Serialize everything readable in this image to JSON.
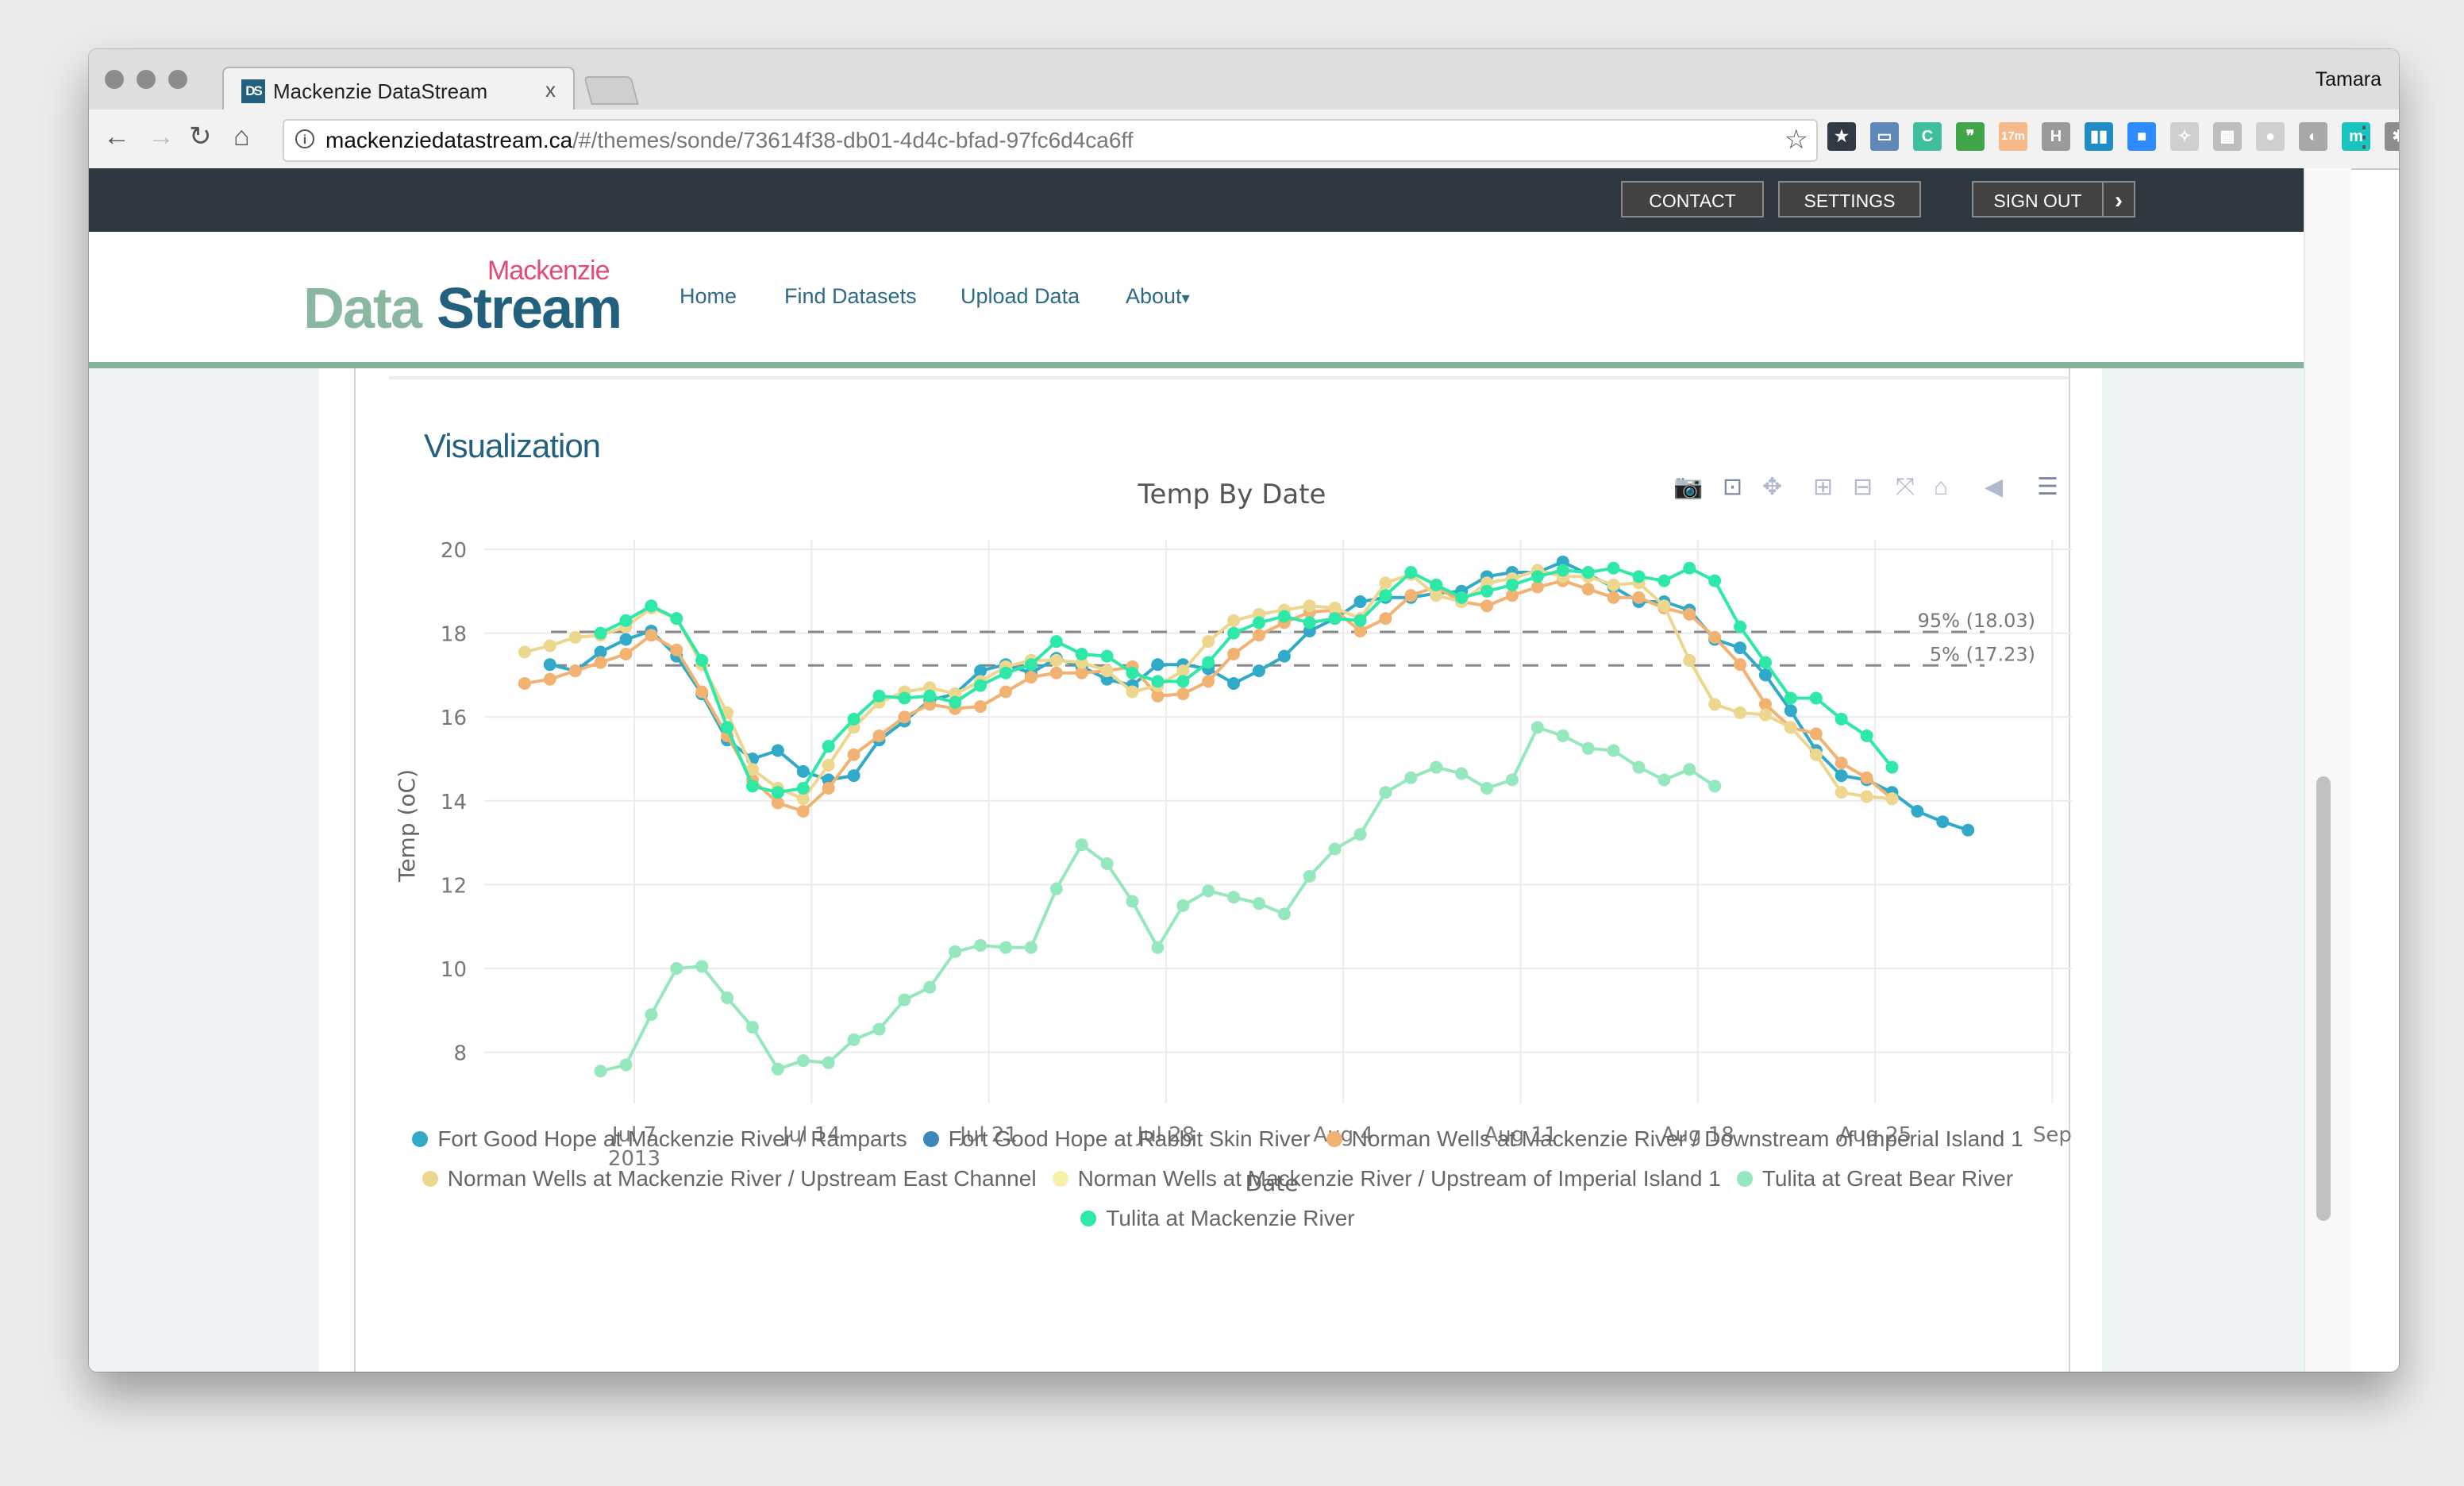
{
  "browser": {
    "tab_title": "Mackenzie DataStream",
    "tab_favicon": "DS",
    "tab_close": "x",
    "profile_name": "Tamara",
    "url_host": "mackenziedatastream.ca",
    "url_path": "/#/themes/sonde/73614f38-db01-4d4c-bfad-97fc6d4ca6ff",
    "extensions": [
      {
        "name": "calendar-star-icon",
        "label": "★",
        "color": "#2f3a45"
      },
      {
        "name": "screen-capture-icon",
        "label": "▭",
        "color": "#5f88b8"
      },
      {
        "name": "c-extension-icon",
        "label": "C",
        "color": "#3fbf9f"
      },
      {
        "name": "hangouts-icon",
        "label": "❞",
        "color": "#3fa548"
      },
      {
        "name": "timer-extension-icon",
        "label": "17m",
        "color": "#f6b98a"
      },
      {
        "name": "h-extension-icon",
        "label": "H",
        "color": "#9a9a9a"
      },
      {
        "name": "trello-icon",
        "label": "▮▮",
        "color": "#1f8dc4"
      },
      {
        "name": "zoom-icon",
        "label": "■",
        "color": "#2d8cff"
      },
      {
        "name": "ghost-extension-icon",
        "label": "✧",
        "color": "#cfcfcf"
      },
      {
        "name": "map-extension-icon",
        "label": "▦",
        "color": "#bdbdbd"
      },
      {
        "name": "dot-extension-icon",
        "label": "●",
        "color": "#cfcfcf"
      },
      {
        "name": "shield-extension-icon",
        "label": "◐",
        "color": "#a8a8a8"
      },
      {
        "name": "m-extension-icon",
        "label": "m",
        "color": "#19c4c0"
      },
      {
        "name": "hubspot-icon",
        "label": "✱",
        "color": "#8d8d8d"
      }
    ]
  },
  "topbar": {
    "contact": "CONTACT",
    "settings": "SETTINGS",
    "signout": "SIGN OUT",
    "signout_arrow": "›"
  },
  "header": {
    "logo_small": "Mackenzie",
    "logo_data": "Data",
    "logo_stream": "Stream",
    "nav": [
      "Home",
      "Find Datasets",
      "Upload Data",
      "About"
    ],
    "about_caret": "▾"
  },
  "section_title": "Visualization",
  "chart_data": {
    "type": "line",
    "title": "Temp By Date",
    "xlabel": "Date",
    "ylabel": "Temp (oC)",
    "x_range": [
      "2013-07-02",
      "2013-09-01"
    ],
    "ylim": [
      6.8,
      20.4
    ],
    "yticks": [
      8,
      10,
      12,
      14,
      16,
      18,
      20
    ],
    "xticks": [
      {
        "date": "2013-07-07",
        "label": "Jul 7",
        "sublabel": "2013"
      },
      {
        "date": "2013-07-14",
        "label": "Jul 14"
      },
      {
        "date": "2013-07-21",
        "label": "Jul 21"
      },
      {
        "date": "2013-07-28",
        "label": "Jul 28"
      },
      {
        "date": "2013-08-04",
        "label": "Aug 4"
      },
      {
        "date": "2013-08-11",
        "label": "Aug 11"
      },
      {
        "date": "2013-08-18",
        "label": "Aug 18"
      },
      {
        "date": "2013-08-25",
        "label": "Aug 25"
      },
      {
        "date": "2013-09-01",
        "label": "Sep"
      }
    ],
    "grid": true,
    "legend_position": "bottom",
    "reference_lines": [
      {
        "label": "95% (18.03)",
        "value": 18.03
      },
      {
        "label": "5% (17.23)",
        "value": 17.23
      }
    ],
    "series": [
      {
        "name": "Fort Good Hope at Mackenzie River / Ramparts",
        "color": "#31a9c9",
        "start": "2013-07-04",
        "values": [
          17.25,
          17.1,
          17.55,
          17.85,
          18.05,
          17.45,
          16.55,
          15.45,
          15.0,
          15.2,
          14.7,
          14.5,
          14.6,
          15.45,
          15.9,
          16.4,
          16.55,
          17.1,
          17.25,
          17.05,
          17.4,
          17.2,
          16.9,
          16.75,
          17.25,
          17.25,
          17.15,
          16.8,
          17.1,
          17.45,
          18.05,
          18.35,
          18.75,
          18.85,
          18.85,
          18.95,
          19.0,
          19.35,
          19.45,
          19.45,
          19.7,
          19.4,
          19.1,
          18.75,
          18.75,
          18.55,
          17.85,
          17.65,
          17.0,
          16.15,
          15.2,
          14.6,
          14.5,
          14.2,
          13.75,
          13.5,
          13.3
        ]
      },
      {
        "name": "Fort Good Hope at Rabbit Skin River",
        "color": "#3f86b8",
        "start": "2013-07-04",
        "values": []
      },
      {
        "name": "Norman Wells at Mackenzie River / Downstream of Imperial Island 1",
        "color": "#f2b272",
        "start": "2013-07-03",
        "values": [
          16.8,
          16.9,
          17.1,
          17.3,
          17.5,
          17.95,
          17.6,
          16.6,
          15.55,
          14.5,
          13.95,
          13.75,
          14.3,
          15.1,
          15.55,
          16.0,
          16.3,
          16.2,
          16.25,
          16.6,
          16.95,
          17.05,
          17.05,
          17.1,
          17.2,
          16.5,
          16.55,
          16.85,
          17.5,
          17.95,
          18.25,
          18.5,
          18.55,
          18.05,
          18.35,
          18.9,
          19.1,
          18.75,
          18.65,
          18.9,
          19.1,
          19.25,
          19.05,
          18.85,
          18.85,
          18.6,
          18.45,
          17.9,
          17.25,
          16.3,
          15.75,
          15.6,
          14.9,
          14.55,
          14.05
        ]
      },
      {
        "name": "Norman Wells at Mackenzie River / Upstream East Channel",
        "color": "#edd68e",
        "start": "2013-07-03",
        "values": [
          17.55,
          17.7,
          17.9,
          17.95,
          18.15,
          18.6,
          18.35,
          17.25,
          16.1,
          14.75,
          14.3,
          14.05,
          14.85,
          15.75,
          16.35,
          16.6,
          16.7,
          16.55,
          16.85,
          17.2,
          17.35,
          17.35,
          17.3,
          17.1,
          16.6,
          16.75,
          17.1,
          17.8,
          18.3,
          18.45,
          18.55,
          18.65,
          18.6,
          18.35,
          19.2,
          19.4,
          18.9,
          18.75,
          19.2,
          19.3,
          19.5,
          19.35,
          19.35,
          19.15,
          19.2,
          18.65,
          17.35,
          16.3,
          16.1,
          16.05,
          15.75,
          15.1,
          14.2,
          14.1,
          14.05
        ]
      },
      {
        "name": "Norman Wells at Mackenzie River / Upstream of Imperial Island 1",
        "color": "#f7f1a8",
        "start": "2013-07-03",
        "values": []
      },
      {
        "name": "Tulita at Great Bear River",
        "color": "#95e8bd",
        "start": "2013-07-06",
        "values": [
          7.55,
          7.7,
          8.9,
          10.0,
          10.05,
          9.3,
          8.6,
          7.6,
          7.8,
          7.75,
          8.3,
          8.55,
          9.25,
          9.55,
          10.4,
          10.55,
          10.5,
          10.5,
          11.9,
          12.95,
          12.5,
          11.6,
          10.5,
          11.5,
          11.85,
          11.7,
          11.55,
          11.3,
          12.2,
          12.85,
          13.2,
          14.2,
          14.55,
          14.8,
          14.65,
          14.3,
          14.5,
          15.75,
          15.55,
          15.25,
          15.2,
          14.8,
          14.5,
          14.75,
          14.35
        ]
      },
      {
        "name": "Tulita at Mackenzie River",
        "color": "#2de8a6",
        "start": "2013-07-06",
        "values": [
          18.0,
          18.3,
          18.65,
          18.35,
          17.35,
          15.75,
          14.35,
          14.2,
          14.3,
          15.3,
          15.95,
          16.5,
          16.45,
          16.5,
          16.35,
          16.75,
          17.05,
          17.25,
          17.8,
          17.5,
          17.45,
          17.05,
          16.85,
          16.85,
          17.3,
          18.0,
          18.25,
          18.4,
          18.25,
          18.35,
          18.3,
          18.9,
          19.45,
          19.15,
          18.85,
          19.0,
          19.15,
          19.35,
          19.5,
          19.45,
          19.55,
          19.35,
          19.25,
          19.55,
          19.25,
          18.15,
          17.3,
          16.45,
          16.45,
          15.95,
          15.55,
          14.8
        ]
      }
    ]
  },
  "modebar": [
    {
      "name": "camera-icon"
    },
    {
      "name": "zoom-box-icon"
    },
    {
      "name": "pan-icon"
    },
    {
      "name": "zoom-in-icon"
    },
    {
      "name": "zoom-out-icon"
    },
    {
      "name": "autoscale-icon"
    },
    {
      "name": "home-reset-icon"
    },
    {
      "name": "hover-closest-icon"
    },
    {
      "name": "hover-compare-icon"
    }
  ]
}
